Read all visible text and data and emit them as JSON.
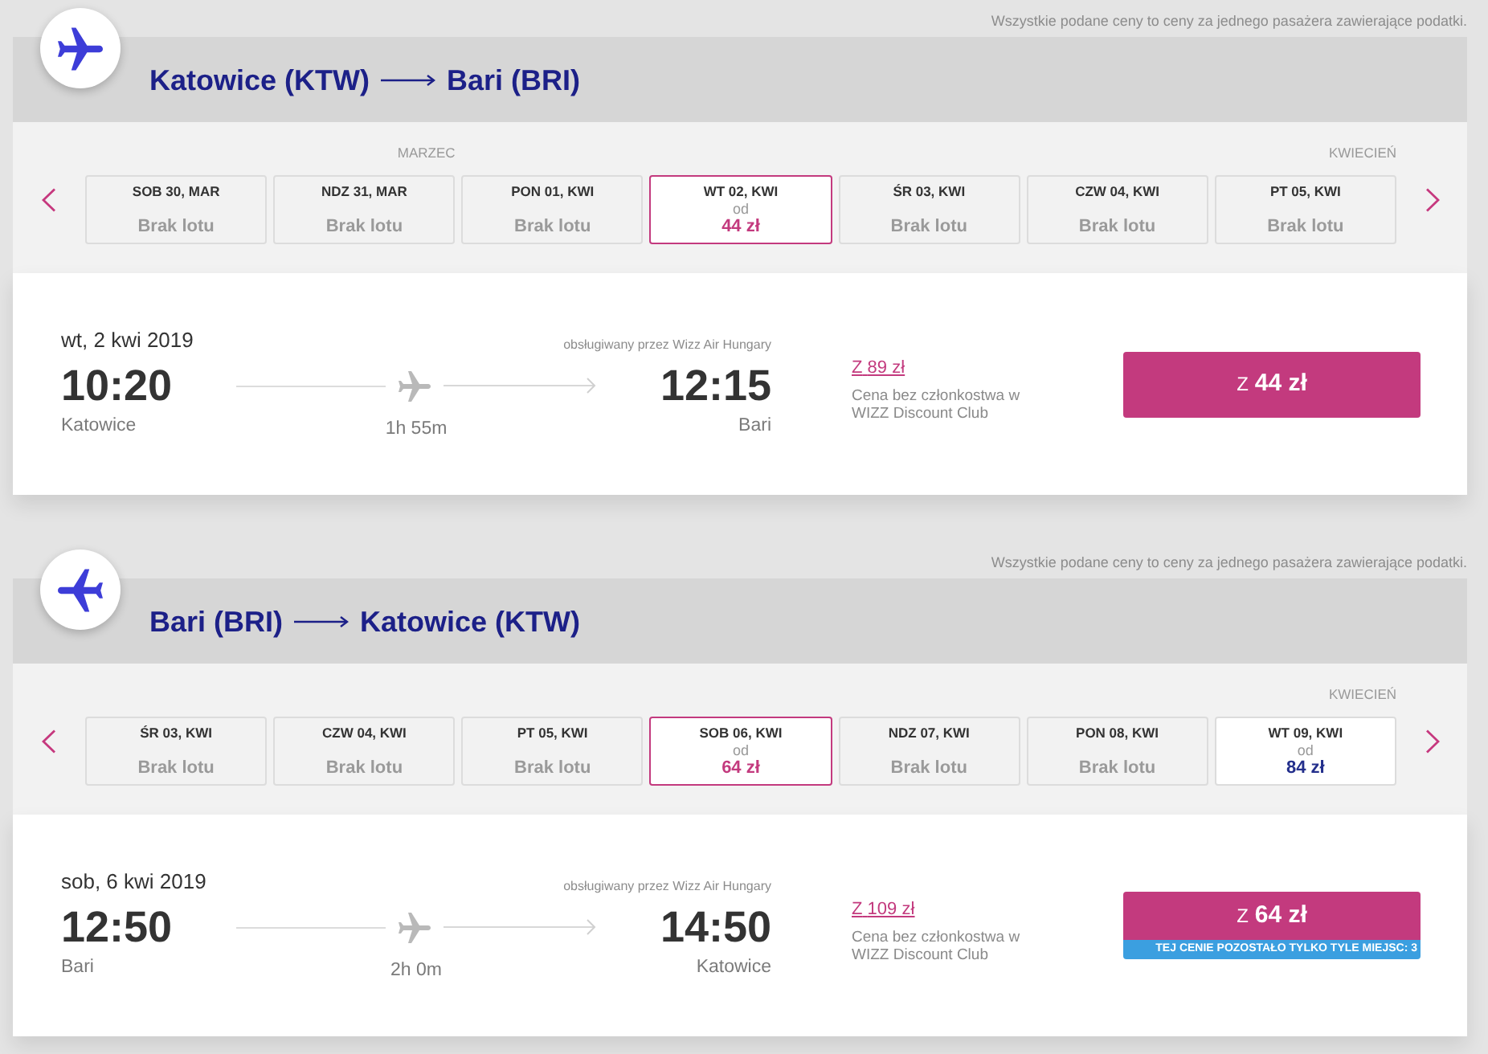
{
  "legs": [
    {
      "kind": "outbound",
      "price_note": "Wszystkie podane ceny to ceny za jednego pasażera zawierające podatki.",
      "origin": "Katowice (KTW)",
      "destination": "Bari (BRI)",
      "dates": [
        {
          "label": "SOB 30, MAR",
          "kind": "no-flight",
          "status": "Brak lotu",
          "selected": false
        },
        {
          "label": "NDZ 31, MAR",
          "month": "MARZEC",
          "kind": "no-flight",
          "status": "Brak lotu",
          "selected": false
        },
        {
          "label": "PON 01, KWI",
          "kind": "no-flight",
          "status": "Brak lotu",
          "selected": false
        },
        {
          "label": "WT 02, KWI",
          "kind": "fare",
          "from": "od",
          "price": "44 zł",
          "selected": true
        },
        {
          "label": "ŚR 03, KWI",
          "kind": "no-flight",
          "status": "Brak lotu",
          "selected": false
        },
        {
          "label": "CZW 04, KWI",
          "kind": "no-flight",
          "status": "Brak lotu",
          "selected": false
        },
        {
          "label": "PT 05, KWI",
          "month": "KWIECIEŃ",
          "kind": "no-flight",
          "status": "Brak lotu",
          "selected": false
        }
      ],
      "flight": {
        "date": "wt, 2 kwi 2019",
        "operator": "obsługiwany przez Wizz Air Hungary",
        "departure_time": "10:20",
        "departure_city": "Katowice",
        "duration": "1h 55m",
        "arrival_time": "12:15",
        "arrival_city": "Bari",
        "club_price": {
          "prefix": "Z",
          "amount": "89 zł"
        },
        "club_note": "Cena bez członkostwa w WIZZ Discount Club",
        "fare_button": {
          "prefix": "Z",
          "amount": "44 zł"
        }
      }
    },
    {
      "kind": "return",
      "price_note": "Wszystkie podane ceny to ceny za jednego pasażera zawierające podatki.",
      "origin": "Bari (BRI)",
      "destination": "Katowice (KTW)",
      "dates": [
        {
          "label": "ŚR 03, KWI",
          "kind": "no-flight",
          "status": "Brak lotu",
          "selected": false
        },
        {
          "label": "CZW 04, KWI",
          "kind": "no-flight",
          "status": "Brak lotu",
          "selected": false
        },
        {
          "label": "PT 05, KWI",
          "kind": "no-flight",
          "status": "Brak lotu",
          "selected": false
        },
        {
          "label": "SOB 06, KWI",
          "kind": "fare",
          "from": "od",
          "price": "64 zł",
          "selected": true
        },
        {
          "label": "NDZ 07, KWI",
          "kind": "no-flight",
          "status": "Brak lotu",
          "selected": false
        },
        {
          "label": "PON 08, KWI",
          "kind": "no-flight",
          "status": "Brak lotu",
          "selected": false
        },
        {
          "label": "WT 09, KWI",
          "month": "KWIECIEŃ",
          "kind": "fare",
          "from": "od",
          "price": "84 zł",
          "selected": false
        }
      ],
      "flight": {
        "date": "sob, 6 kwi 2019",
        "operator": "obsługiwany przez Wizz Air Hungary",
        "departure_time": "12:50",
        "departure_city": "Bari",
        "duration": "2h 0m",
        "arrival_time": "14:50",
        "arrival_city": "Katowice",
        "club_price": {
          "prefix": "Z",
          "amount": "109 zł"
        },
        "club_note": "Cena bez członkostwa w WIZZ Discount Club",
        "fare_button": {
          "prefix": "Z",
          "amount": "64 zł"
        },
        "seats_notice": "TEJ CENIE POZOSTAŁO TYLKO TYLE MIEJSC: 3"
      }
    }
  ]
}
